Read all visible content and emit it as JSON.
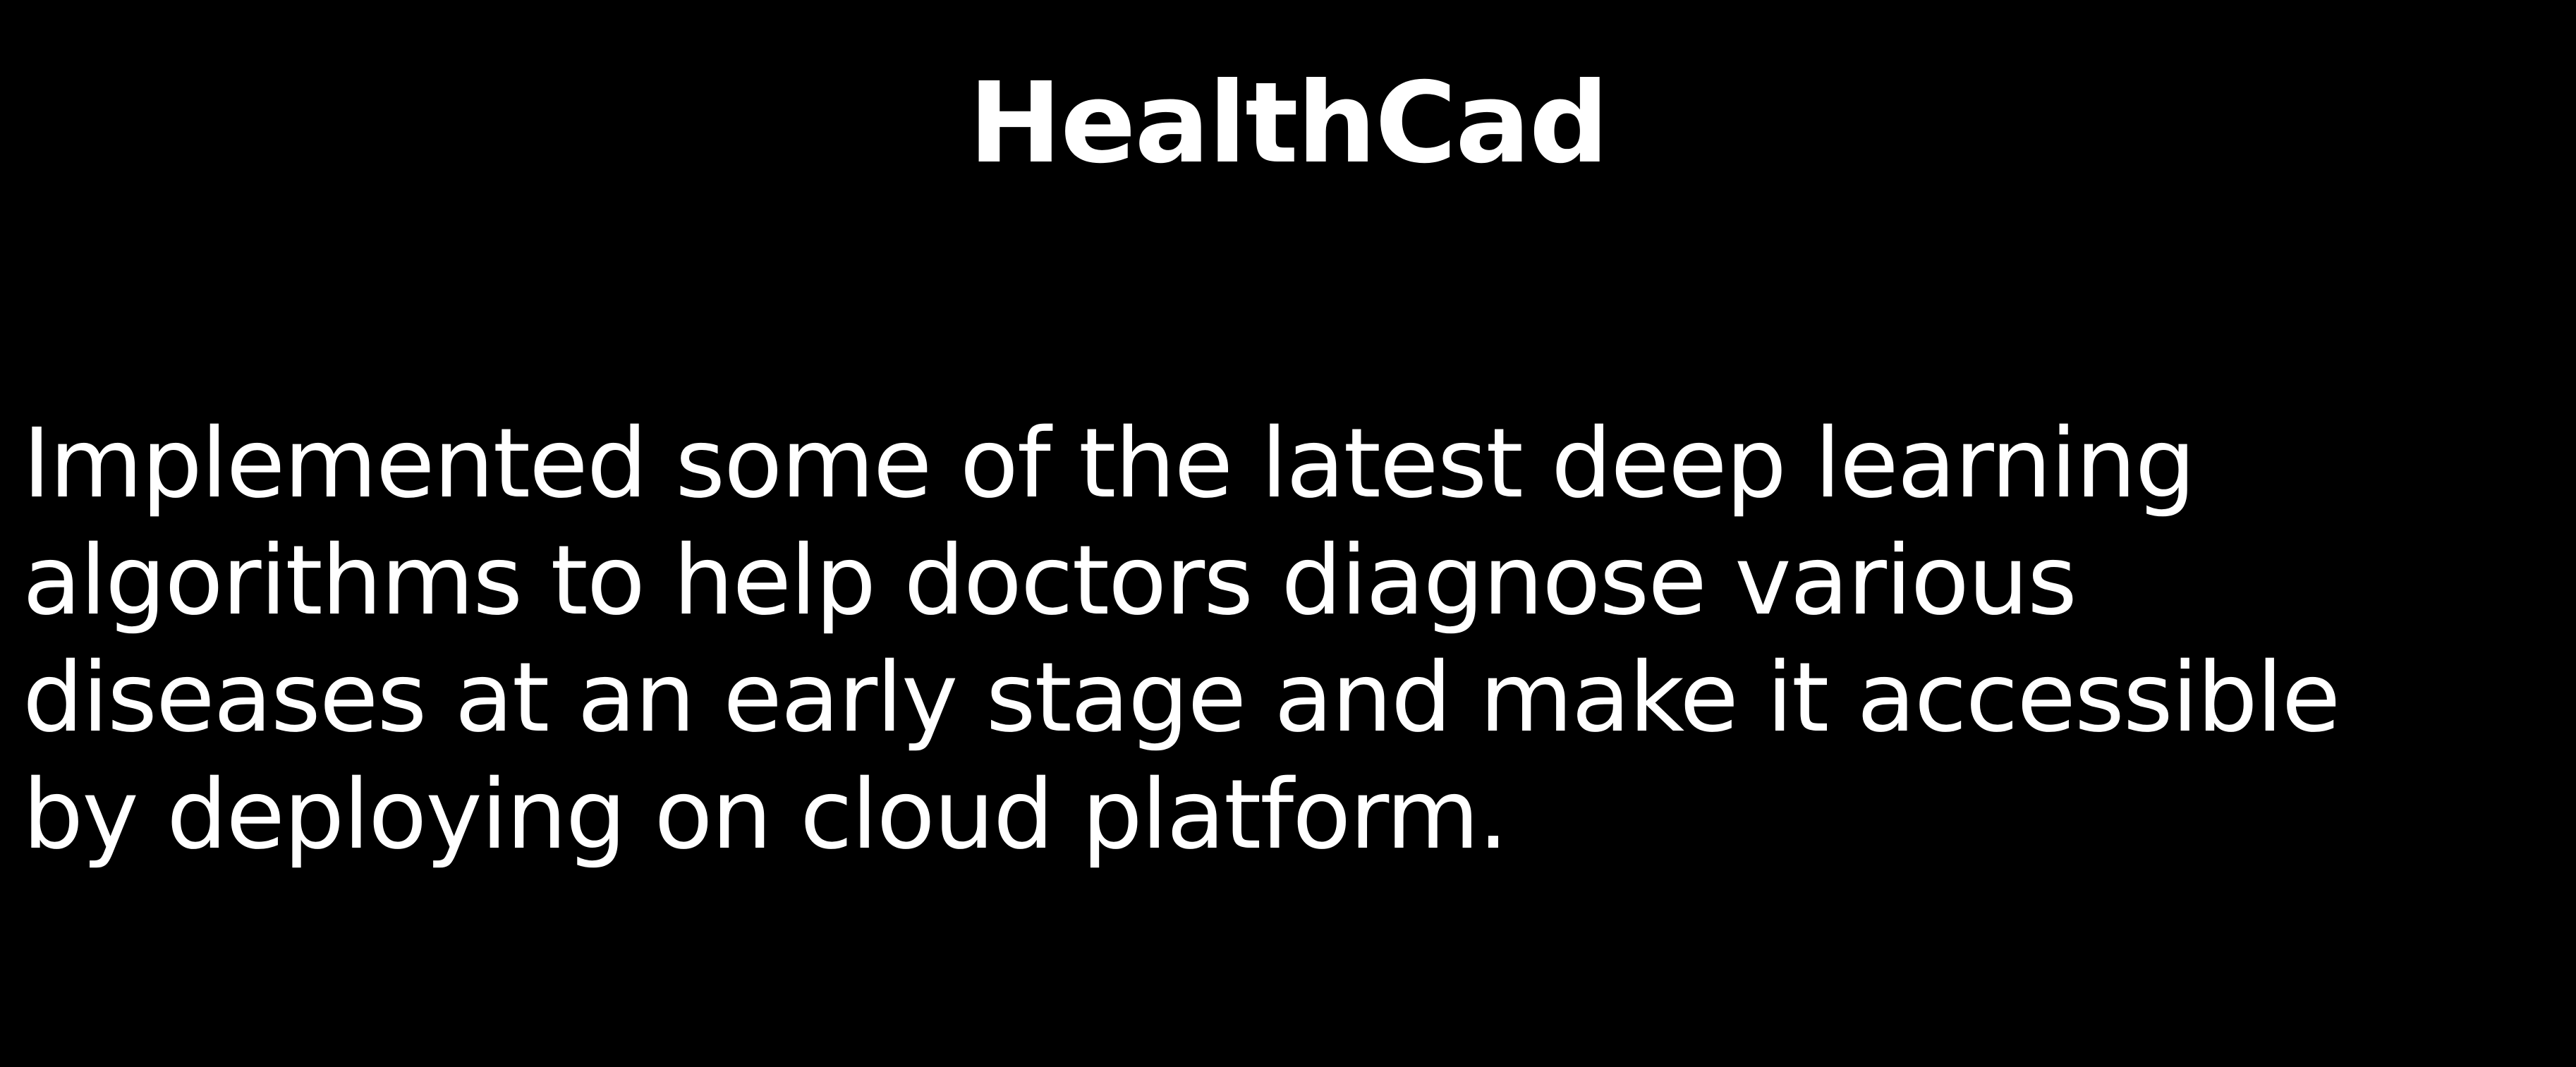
{
  "slide": {
    "title": "HealthCad",
    "description_lines": [
      "Implemented some of the latest deep learning",
      "algorithms to help doctors diagnose various",
      "diseases at an early stage and make it accessible",
      "by deploying on cloud platform."
    ]
  },
  "colors": {
    "background": "#000000",
    "text": "#ffffff"
  }
}
